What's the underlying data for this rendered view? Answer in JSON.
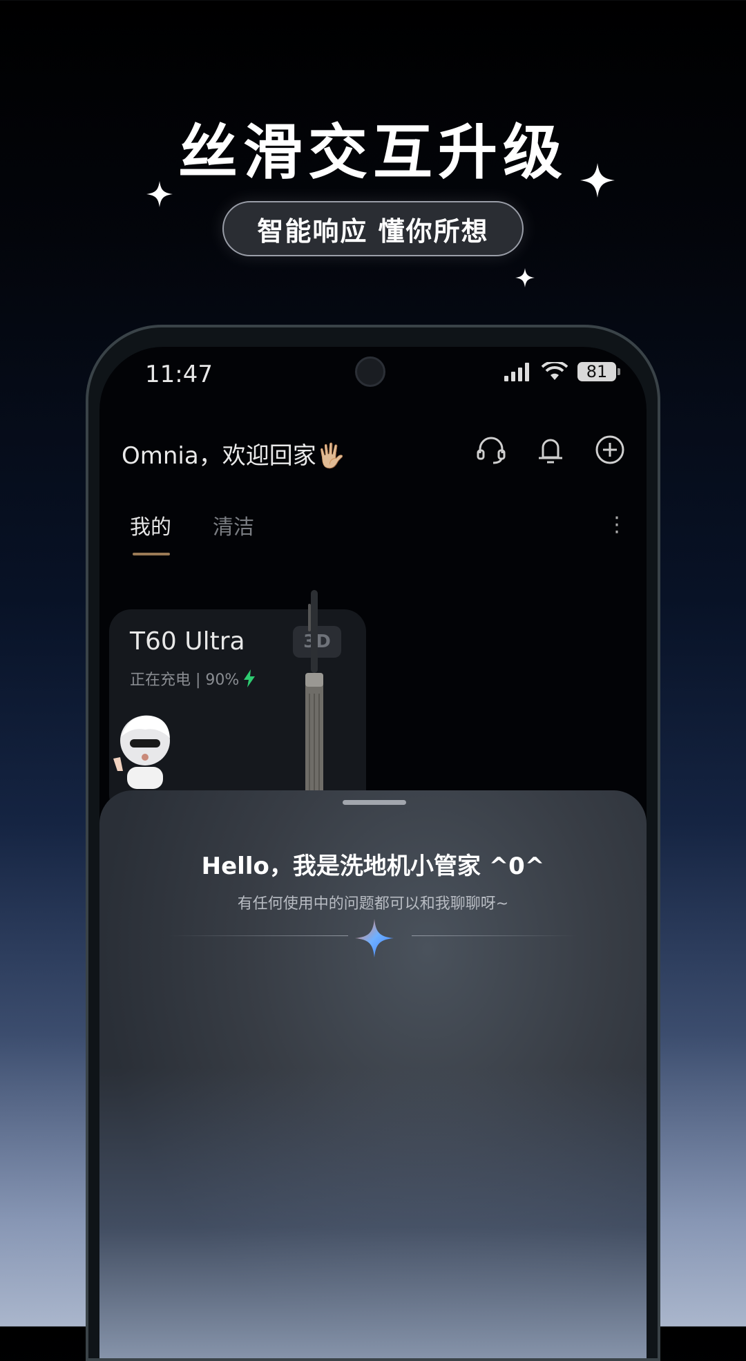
{
  "promo": {
    "headline": "丝滑交互升级",
    "pill_text": "智能响应 懂你所想"
  },
  "status_bar": {
    "time": "11:47",
    "battery": "81",
    "icons": [
      "signal-icon",
      "wifi-icon",
      "battery-icon"
    ]
  },
  "header": {
    "welcome": "Omnia，欢迎回家🖐🏼",
    "icons": [
      "headset-icon",
      "bell-icon",
      "add-circle-icon"
    ]
  },
  "tabs": [
    {
      "label": "我的",
      "active": true
    },
    {
      "label": "清洁",
      "active": false
    }
  ],
  "device_card": {
    "name": "T60 Ultra",
    "status": "正在充电 | 90%",
    "badge": "3D",
    "accent_color": "#2ecc71"
  },
  "assistant_sheet": {
    "greeting": "Hello，我是洗地机小管家 ^0^",
    "subtitle": "有任何使用中的问题都可以和我聊聊呀~"
  }
}
